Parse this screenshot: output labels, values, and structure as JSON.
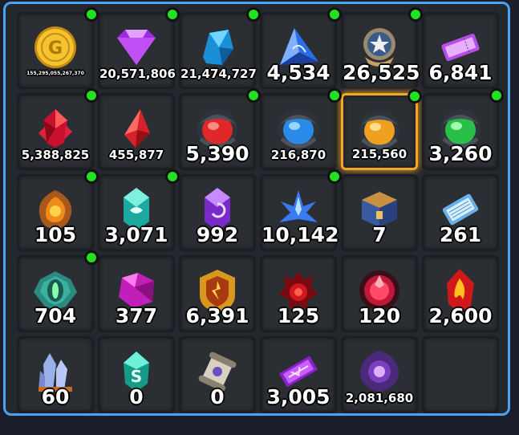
{
  "inventory": {
    "rows": [
      [
        {
          "name": "gold-coin-icon",
          "count": "155,295,055,267,370",
          "size": "xs",
          "dot": true
        },
        {
          "name": "purple-gem-icon",
          "count": "20,571,806",
          "size": "md",
          "dot": true
        },
        {
          "name": "blue-crystal-icon",
          "count": "21,474,727",
          "size": "md",
          "dot": true
        },
        {
          "name": "blue-triangle-shard-icon",
          "count": "4,534",
          "size": "xl",
          "dot": true
        },
        {
          "name": "star-medal-icon",
          "count": "26,525",
          "size": "xl",
          "dot": true
        },
        {
          "name": "purple-ticket-icon",
          "count": "6,841",
          "size": "xl",
          "dot": false
        }
      ],
      [
        {
          "name": "red-crystal-cluster-icon",
          "count": "5,388,825",
          "size": "md",
          "dot": true
        },
        {
          "name": "red-shard-icon",
          "count": "455,877",
          "size": "md",
          "dot": false
        },
        {
          "name": "red-orb-egg-icon",
          "count": "5,390",
          "size": "xl",
          "dot": true
        },
        {
          "name": "blue-orb-egg-icon",
          "count": "216,870",
          "size": "md",
          "dot": true
        },
        {
          "name": "orange-orb-egg-icon",
          "count": "215,560",
          "size": "md",
          "dot": true,
          "selected": true
        },
        {
          "name": "green-orb-egg-icon",
          "count": "3,260",
          "size": "xl",
          "dot": true
        }
      ],
      [
        {
          "name": "orange-stone-icon",
          "count": "105",
          "size": "xl",
          "dot": true
        },
        {
          "name": "teal-crystal-icon",
          "count": "3,071",
          "size": "xl",
          "dot": true
        },
        {
          "name": "purple-crystal-icon",
          "count": "992",
          "size": "xl",
          "dot": false
        },
        {
          "name": "blue-lotus-crystal-icon",
          "count": "10,142",
          "size": "xl",
          "dot": true
        },
        {
          "name": "treasure-box-icon",
          "count": "7",
          "size": "xl",
          "dot": false
        },
        {
          "name": "blue-card-icon",
          "count": "261",
          "size": "xl",
          "dot": false
        }
      ],
      [
        {
          "name": "green-eye-emblem-icon",
          "count": "704",
          "size": "xl",
          "dot": true
        },
        {
          "name": "magenta-gem-icon",
          "count": "377",
          "size": "xl",
          "dot": false
        },
        {
          "name": "gold-crest-icon",
          "count": "6,391",
          "size": "xl",
          "dot": false
        },
        {
          "name": "red-crown-emblem-icon",
          "count": "125",
          "size": "xl",
          "dot": false
        },
        {
          "name": "red-orb-emblem-icon",
          "count": "120",
          "size": "xl",
          "dot": false
        },
        {
          "name": "red-flame-shard-icon",
          "count": "2,600",
          "size": "xl",
          "dot": false
        }
      ],
      [
        {
          "name": "crystal-cluster-icon",
          "count": "60",
          "size": "xl",
          "dot": false
        },
        {
          "name": "teal-s-crystal-icon",
          "count": "0",
          "size": "xl",
          "dot": false
        },
        {
          "name": "scroll-icon",
          "count": "0",
          "size": "xl",
          "dot": false
        },
        {
          "name": "purple-talisman-icon",
          "count": "3,005",
          "size": "xl",
          "dot": false
        },
        {
          "name": "dark-purple-orb-icon",
          "count": "2,081,680",
          "size": "md",
          "dot": false
        },
        {
          "name": "empty",
          "count": "",
          "size": "xl",
          "dot": false,
          "empty": true
        }
      ]
    ]
  }
}
